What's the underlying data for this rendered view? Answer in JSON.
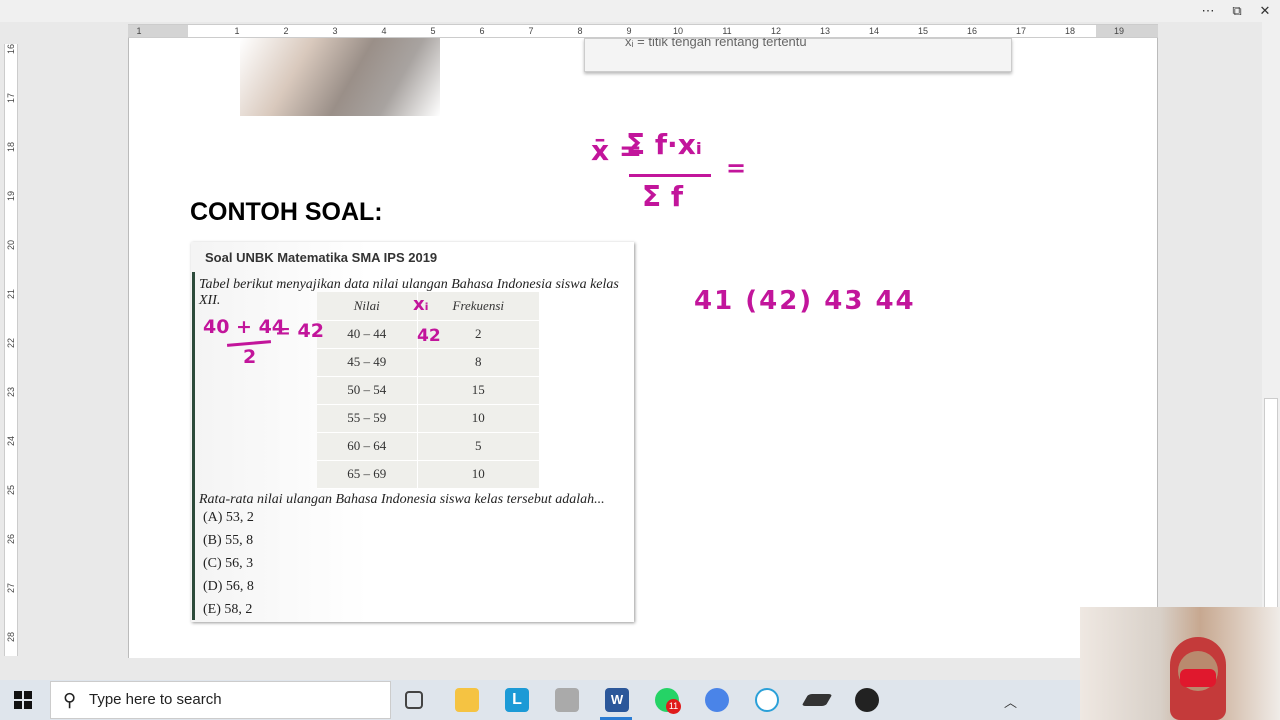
{
  "window": {
    "controls": [
      "...",
      "restore",
      "close"
    ]
  },
  "ruler": {
    "h_labels": [
      "1",
      "1",
      "2",
      "3",
      "4",
      "5",
      "6",
      "7",
      "8",
      "9",
      "10",
      "11",
      "12",
      "13",
      "14",
      "15",
      "16",
      "17",
      "18",
      "19"
    ],
    "v_labels": [
      "16",
      "17",
      "18",
      "19",
      "20",
      "21",
      "22",
      "23",
      "24",
      "25",
      "26",
      "27",
      "28"
    ]
  },
  "callout": {
    "text": "xᵢ = titik tengah rentang tertentu"
  },
  "heading": "CONTOH SOAL:",
  "card": {
    "source": "Soal UNBK Matematika SMA IPS 2019",
    "intro": "Tabel berikut menyajikan data nilai ulangan Bahasa Indonesia siswa kelas XII.",
    "table": {
      "headers": [
        "Nilai",
        "Frekuensi"
      ],
      "rows": [
        [
          "40 – 44",
          "2"
        ],
        [
          "45 – 49",
          "8"
        ],
        [
          "50 – 54",
          "15"
        ],
        [
          "55 – 59",
          "10"
        ],
        [
          "60 – 64",
          "5"
        ],
        [
          "65 – 69",
          "10"
        ]
      ]
    },
    "question": "Rata-rata nilai ulangan Bahasa Indonesia siswa kelas tersebut adalah...",
    "options": [
      "(A) 53, 2",
      "(B) 55, 8",
      "(C) 56, 3",
      "(D) 56, 8",
      "(E) 58, 2"
    ]
  },
  "handwriting": {
    "formula_lhs": "x̄ =",
    "formula_num": "Σ f·xᵢ",
    "formula_den": "Σ f",
    "formula_eq": "=",
    "xi_header": "xᵢ",
    "xi_value": "42",
    "midpoint_num": "40 + 44",
    "midpoint_den": "2",
    "midpoint_result": "= 42",
    "sequence": "41 (42) 43 44"
  },
  "colors": {
    "ink": "#c2159b"
  },
  "taskbar": {
    "search_placeholder": "Type here to search",
    "whatsapp_badge": "11"
  }
}
